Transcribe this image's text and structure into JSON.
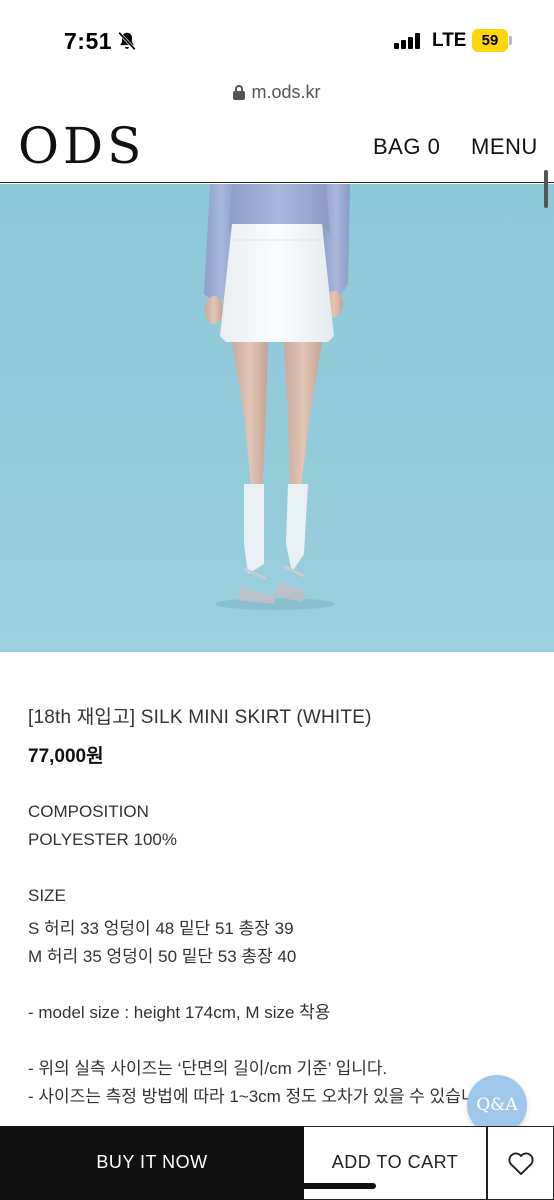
{
  "status_bar": {
    "time": "7:51",
    "network": "LTE",
    "battery": "59",
    "battery_color": "#ffd60a"
  },
  "browser": {
    "url": "m.ods.kr"
  },
  "header": {
    "logo": "ODS",
    "bag_label": "BAG 0",
    "menu_label": "MENU"
  },
  "product": {
    "title": "[18th 재입고] SILK MINI SKIRT (WHITE)",
    "price": "77,000원",
    "description": [
      "COMPOSITION",
      "POLYESTER 100%",
      "",
      "SIZE",
      "S 허리 33 엉덩이 48 밑단 51 총장 39",
      "M 허리 35 엉덩이 50 밑단 53 총장 40",
      "",
      "- model size : height 174cm, M size 착용",
      "",
      "- 위의 실측 사이즈는 ‘단면의 길이/cm 기준’ 입니다.",
      "- 사이즈는 측정 방법에 따라 1~3cm 정도 오차가 있을 수 있습니"
    ]
  },
  "qa_button": "Q&A",
  "actions": {
    "buy_now": "BUY IT NOW",
    "add_to_cart": "ADD TO CART",
    "wishlist_icon": "heart-icon"
  },
  "colors": {
    "hero_background": "#93cbd9",
    "qa_button": "#9fc7ea",
    "buy_button": "#111111"
  }
}
